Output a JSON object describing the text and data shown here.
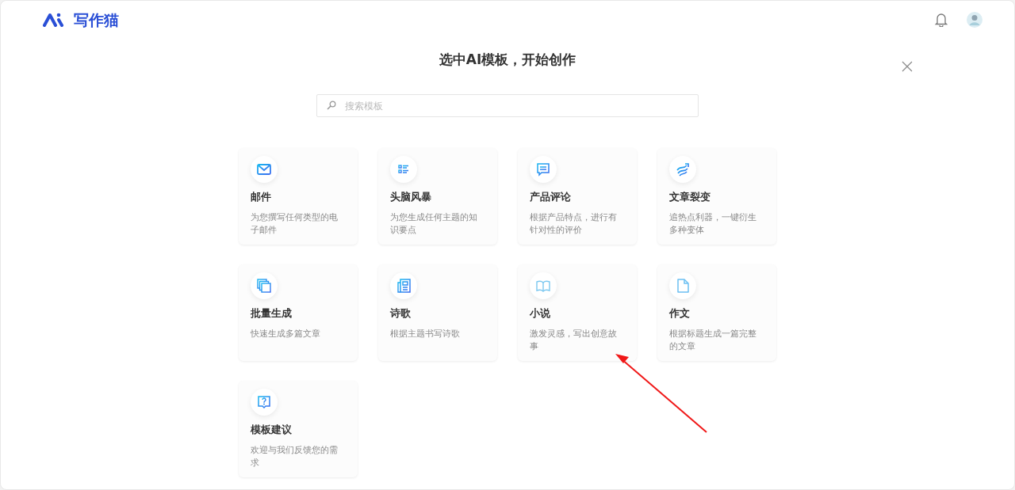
{
  "header": {
    "logo_text": "写作猫"
  },
  "dialog": {
    "title": "选中AI模板，开始创作",
    "search": {
      "placeholder": "搜索模板"
    }
  },
  "templates": [
    {
      "title": "邮件",
      "description": "为您撰写任何类型的电子邮件"
    },
    {
      "title": "头脑风暴",
      "description": "为您生成任何主题的知识要点"
    },
    {
      "title": "产品评论",
      "description": "根据产品特点，进行有针对性的评价"
    },
    {
      "title": "文章裂变",
      "description": "追热点利器，一键衍生多种变体"
    },
    {
      "title": "批量生成",
      "description": "快速生成多篇文章"
    },
    {
      "title": "诗歌",
      "description": "根据主题书写诗歌"
    },
    {
      "title": "小说",
      "description": "激发灵感，写出创意故事"
    },
    {
      "title": "作文",
      "description": "根据标题生成一篇完整的文章"
    },
    {
      "title": "模板建议",
      "description": "欢迎与我们反馈您的需求"
    }
  ],
  "annotation": {
    "kind": "arrow"
  }
}
